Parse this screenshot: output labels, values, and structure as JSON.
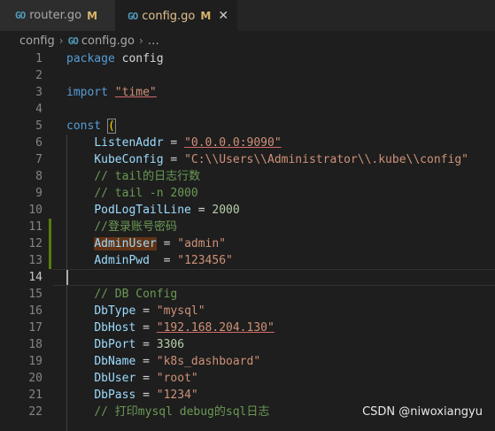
{
  "tabs": [
    {
      "icon": "go-icon",
      "label": "router.go",
      "badge": "M"
    },
    {
      "icon": "go-icon",
      "label": "config.go",
      "badge": "M",
      "close": "✕"
    }
  ],
  "breadcrumb": {
    "folder": "config",
    "sep": "›",
    "file": "config.go",
    "more": "…"
  },
  "lines": [
    {
      "num": "1"
    },
    {
      "num": "2"
    },
    {
      "num": "3"
    },
    {
      "num": "4"
    },
    {
      "num": "5"
    },
    {
      "num": "6"
    },
    {
      "num": "7"
    },
    {
      "num": "8"
    },
    {
      "num": "9"
    },
    {
      "num": "10"
    },
    {
      "num": "11"
    },
    {
      "num": "12"
    },
    {
      "num": "13"
    },
    {
      "num": "14"
    },
    {
      "num": "15"
    },
    {
      "num": "16"
    },
    {
      "num": "17"
    },
    {
      "num": "18"
    },
    {
      "num": "19"
    },
    {
      "num": "20"
    },
    {
      "num": "21"
    },
    {
      "num": "22"
    }
  ],
  "code": {
    "l1_kw": "package",
    "l1_pk": " config",
    "l3_kw": "import",
    "l3_str": "\"time\"",
    "l5_kw": "const",
    "l5_par": "(",
    "l6_id": "ListenAddr",
    "l6_eq": " = ",
    "l6_str": "\"0.0.0.0:9090\"",
    "l7_id": "KubeConfig",
    "l7_eq": " = ",
    "l7_str": "\"C:\\\\Users\\\\Administrator\\\\.kube\\\\config\"",
    "l8_cm": "// tail的日志行数",
    "l9_cm": "// tail -n 2000",
    "l10_id": "PodLogTailLine",
    "l10_eq": " = ",
    "l10_num": "2000",
    "l11_cm": "//登录账号密码",
    "l12_id": "AdminUser",
    "l12_eq": " = ",
    "l12_str": "\"admin\"",
    "l13_id": "AdminPwd",
    "l13_eq": "  = ",
    "l13_str": "\"123456\"",
    "l15_cm": "// DB Config",
    "l16_id": "DbType",
    "l16_eq": " = ",
    "l16_str": "\"mysql\"",
    "l17_id": "DbHost",
    "l17_eq": " = ",
    "l17_str": "\"192.168.204.130\"",
    "l18_id": "DbPort",
    "l18_eq": " = ",
    "l18_num": "3306",
    "l19_id": "DbName",
    "l19_eq": " = ",
    "l19_str": "\"k8s_dashboard\"",
    "l20_id": "DbUser",
    "l20_eq": " = ",
    "l20_str": "\"root\"",
    "l21_id": "DbPass",
    "l21_eq": " = ",
    "l21_str": "\"1234\"",
    "l22_cm": "// 打印mysql debug的sql日志"
  },
  "watermark": "CSDN @niwoxiangyu",
  "colors": {
    "keyword": "#569cd6",
    "string": "#ce9178",
    "number": "#b5cea8",
    "identifier": "#9cdcfe",
    "comment": "#6a9955",
    "modified": "#587c0c"
  }
}
